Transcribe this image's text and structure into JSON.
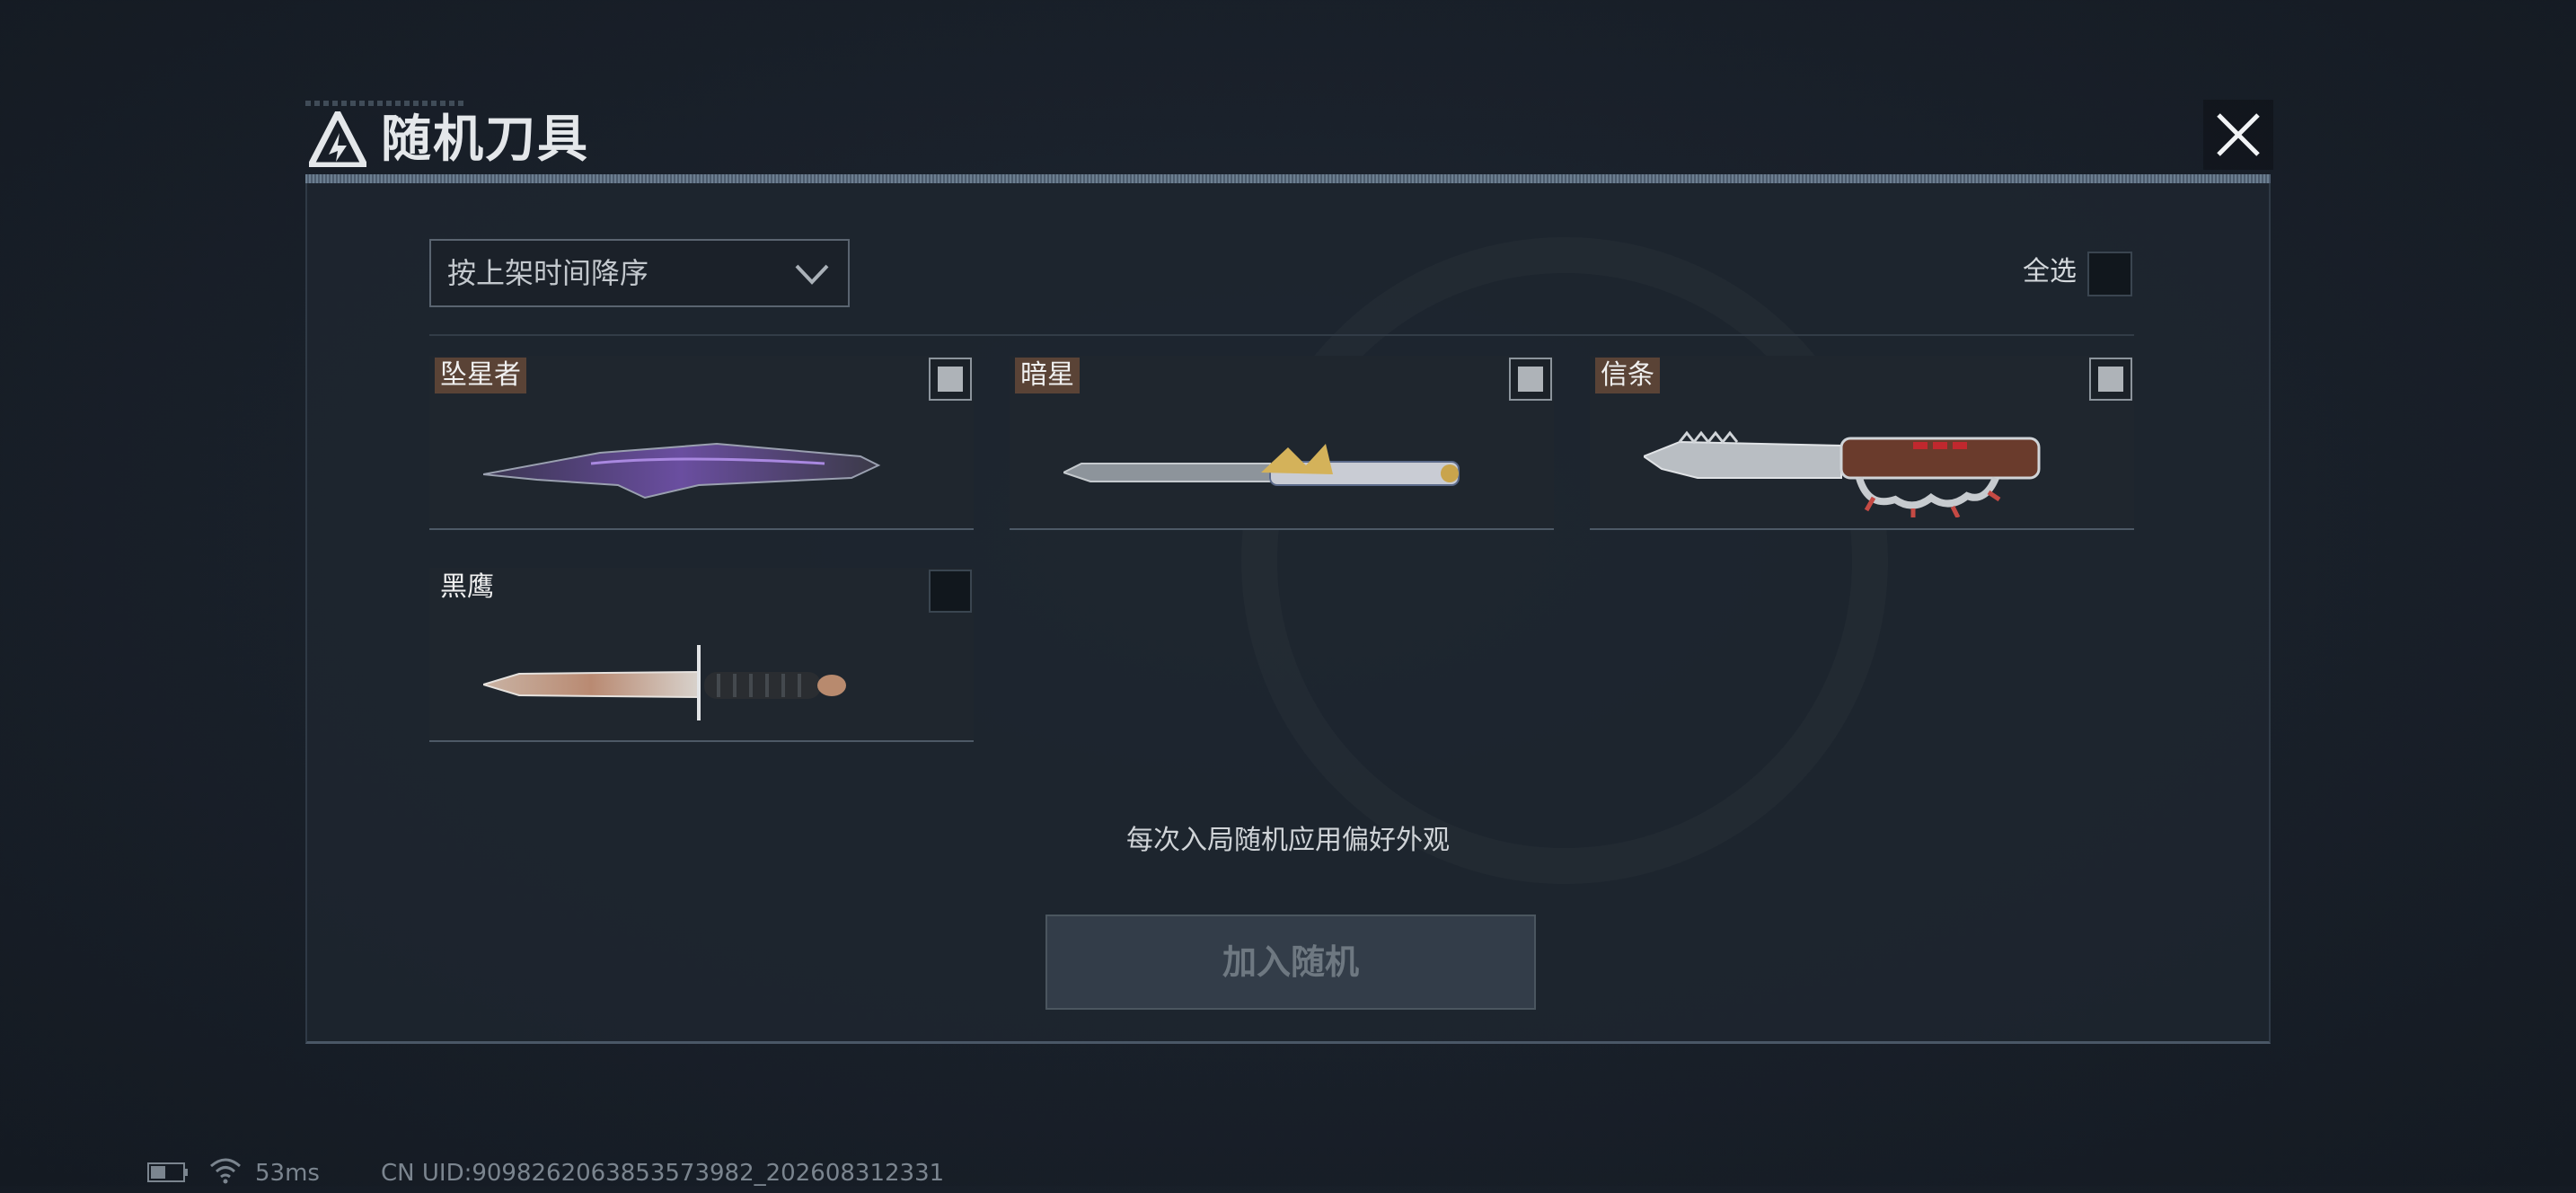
{
  "header": {
    "title": "随机刀具",
    "logo_icon": "triangle-logo-icon",
    "close_icon": "close-icon"
  },
  "sort": {
    "selected": "按上架时间降序",
    "icon": "chevron-down-icon"
  },
  "select_all": {
    "label": "全选",
    "checked": false
  },
  "knives": [
    {
      "name": "坠星者",
      "checked": true,
      "icon": "purple-blade-knife"
    },
    {
      "name": "暗星",
      "checked": true,
      "icon": "gold-hilt-knife"
    },
    {
      "name": "信条",
      "checked": true,
      "icon": "knuckle-knife"
    },
    {
      "name": "黑鹰",
      "checked": false,
      "icon": "combat-dagger"
    }
  ],
  "hint": "每次入局随机应用偏好外观",
  "join_button": {
    "label": "加入随机"
  },
  "status_bar": {
    "ping": "53ms",
    "uid": "CN UID:9098262063853573982_202608312331",
    "battery_icon": "battery-icon",
    "wifi_icon": "wifi-icon"
  }
}
